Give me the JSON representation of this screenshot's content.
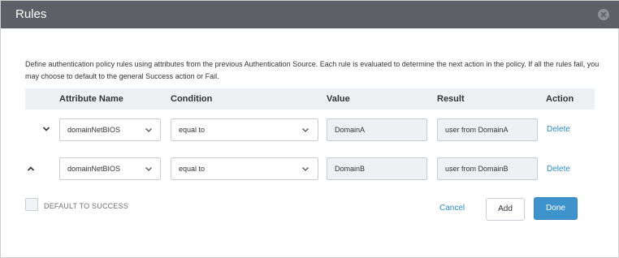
{
  "dialog": {
    "title": "Rules",
    "description": "Define authentication policy rules using attributes from the previous Authentication Source. Each rule is evaluated to determine the next action in the policy. If all the rules fail, you may choose to default to the general Success action or Fail."
  },
  "table": {
    "headers": {
      "attribute": "Attribute Name",
      "condition": "Condition",
      "value": "Value",
      "result": "Result",
      "action": "Action"
    },
    "rows": [
      {
        "attribute": "domainNetBIOS",
        "condition": "equal to",
        "value": "DomainA",
        "result": "user from DomainA",
        "action": "Delete"
      },
      {
        "attribute": "domainNetBIOS",
        "condition": "equal to",
        "value": "DomainB",
        "result": "user from DomainB",
        "action": "Delete"
      }
    ]
  },
  "footer": {
    "default_label": "DEFAULT TO SUCCESS",
    "cancel": "Cancel",
    "add": "Add",
    "done": "Done"
  },
  "colors": {
    "header_bg": "#5d6167",
    "table_header_bg": "#eef1f4",
    "link": "#2d8ac7",
    "primary": "#3e93cc"
  }
}
